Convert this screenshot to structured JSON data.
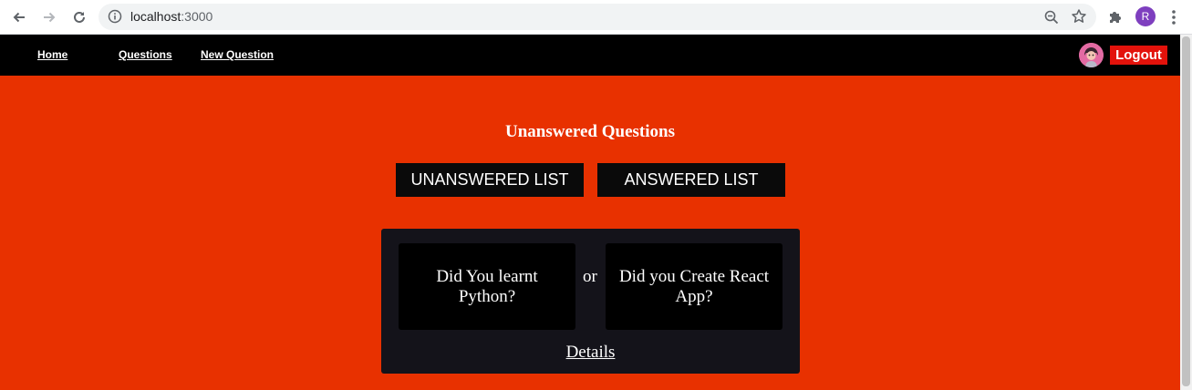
{
  "browser": {
    "url_host": "localhost",
    "url_port": ":3000",
    "profile_initial": "R"
  },
  "nav": {
    "links": [
      "Home",
      "Questions",
      "New Question"
    ],
    "logout_label": "Logout"
  },
  "main": {
    "heading": "Unanswered Questions",
    "tabs": [
      "UNANSWERED LIST",
      "ANSWERED LIST"
    ],
    "question": {
      "option_one": "Did You learnt Python?",
      "separator": "or",
      "option_two": "Did you Create React App?",
      "details_label": "Details"
    }
  },
  "colors": {
    "page_background": "#e83100",
    "navbar": "#000000",
    "logout_button": "#e3120b",
    "card": "#14131a"
  }
}
